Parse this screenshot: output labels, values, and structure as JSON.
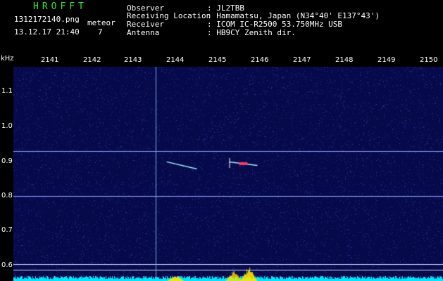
{
  "header": {
    "title": "HROFFT",
    "filename": "1312172140.png",
    "datetime": "13.12.17 21:40",
    "counter_label": "meteor",
    "counter_value": "7",
    "fields": [
      {
        "label": "Observer",
        "value": ": JL2TBB"
      },
      {
        "label": "Receiving Location",
        "value": ": Hamamatsu, Japan (N34°40' E137°43')"
      },
      {
        "label": "Receiver",
        "value": ": ICOM IC-R2500 53.750MHz USB"
      },
      {
        "label": "Antenna",
        "value": ": HB9CY Zenith dir."
      }
    ]
  },
  "chart_data": {
    "type": "heatmap",
    "x_unit": "",
    "y_unit": "kHz",
    "x_ticks": [
      "2141",
      "2142",
      "2143",
      "2144",
      "2145",
      "2146",
      "2147",
      "2148",
      "2149",
      "2150"
    ],
    "y_ticks": [
      "1.1",
      "1.0",
      "0.9",
      "0.8",
      "0.7",
      "0.6"
    ],
    "x_range": [
      2140.75,
      2150.7
    ],
    "y_range": [
      0.573,
      1.17
    ],
    "colors": {
      "background": "#060a4a",
      "noise": "#3a4ad8",
      "line": "#8ea0ff",
      "baseline": "#00e6ff",
      "peak": "#ffe800",
      "hot": "#ff3a6a"
    },
    "constant_lines_khz": [
      0.935,
      0.81,
      0.62,
      0.605
    ],
    "vertical_marker_x": 2144.05,
    "meteor_echoes": [
      {
        "x_start": 2144.3,
        "x_end": 2145.0,
        "y_start": 0.905,
        "y_end": 0.885
      },
      {
        "x_start": 2145.75,
        "x_end": 2146.4,
        "y_start": 0.905,
        "y_end": 0.895
      }
    ],
    "spectrum_peaks": [
      {
        "x": 2144.5,
        "height": 0.3
      },
      {
        "x": 2145.85,
        "height": 0.55
      },
      {
        "x": 2146.2,
        "height": 0.75
      }
    ]
  }
}
